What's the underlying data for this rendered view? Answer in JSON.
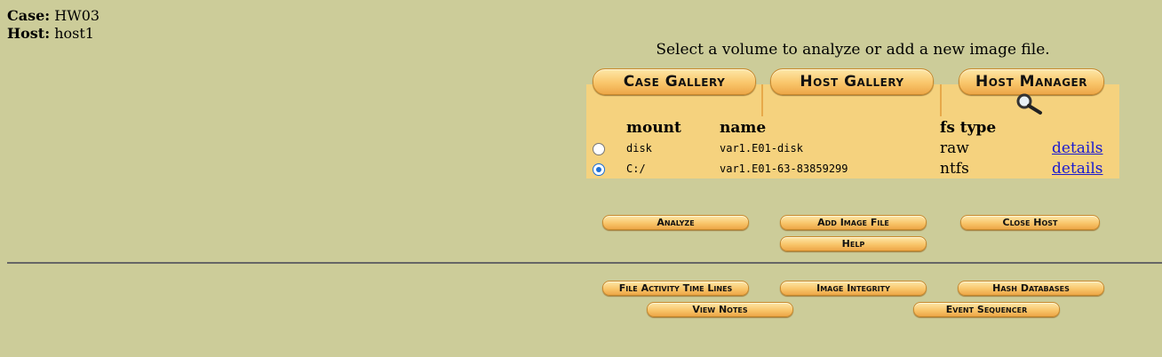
{
  "case": {
    "label": "Case:",
    "value": "HW03"
  },
  "host": {
    "label": "Host:",
    "value": "host1"
  },
  "prompt": "Select a volume to analyze or add a new image file.",
  "tabs": {
    "case_gallery": "Case Gallery",
    "host_gallery": "Host Gallery",
    "host_manager": "Host Manager"
  },
  "table": {
    "headers": {
      "mount": "mount",
      "name": "name",
      "fstype": "fs type"
    },
    "rows": [
      {
        "mount": "disk",
        "name": "var1.E01-disk",
        "fstype": "raw",
        "details": "details",
        "selected": false
      },
      {
        "mount": "C:/",
        "name": "var1.E01-63-83859299",
        "fstype": "ntfs",
        "details": "details",
        "selected": true
      }
    ]
  },
  "actions": {
    "analyze": "Analyze",
    "add_image": "Add Image File",
    "close_host": "Close Host",
    "help": "Help"
  },
  "tools": {
    "timelines": "File Activity Time Lines",
    "integrity": "Image Integrity",
    "hashdb": "Hash Databases",
    "notes": "View Notes",
    "sequencer": "Event Sequencer"
  },
  "icons": {
    "host_manager_icon": "magnifier-icon"
  }
}
